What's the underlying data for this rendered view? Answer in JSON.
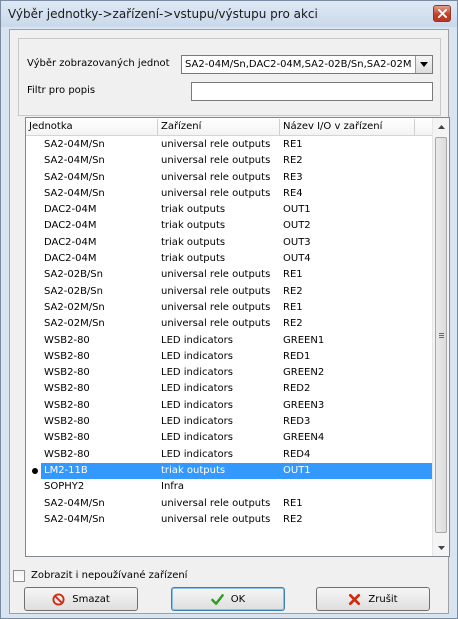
{
  "window": {
    "title": "Výběr jednotky->zařízení->vstupu/výstupu pro akci"
  },
  "filter": {
    "units_label": "Výběr zobrazovaných jednot",
    "units_value": "SA2-04M/Sn,DAC2-04M,SA2-02B/Sn,SA2-02M",
    "description_label": "Filtr pro popis",
    "description_value": ""
  },
  "table": {
    "columns": [
      "Jednotka",
      "Zařízení",
      "Název I/O v zařízení"
    ],
    "rows": [
      {
        "unit": "SA2-04M/Sn",
        "device": "universal rele outputs",
        "io": "RE1"
      },
      {
        "unit": "SA2-04M/Sn",
        "device": "universal rele outputs",
        "io": "RE2"
      },
      {
        "unit": "SA2-04M/Sn",
        "device": "universal rele outputs",
        "io": "RE3"
      },
      {
        "unit": "SA2-04M/Sn",
        "device": "universal rele outputs",
        "io": "RE4"
      },
      {
        "unit": "DAC2-04M",
        "device": "triak outputs",
        "io": "OUT1"
      },
      {
        "unit": "DAC2-04M",
        "device": "triak outputs",
        "io": "OUT2"
      },
      {
        "unit": "DAC2-04M",
        "device": "triak outputs",
        "io": "OUT3"
      },
      {
        "unit": "DAC2-04M",
        "device": "triak outputs",
        "io": "OUT4"
      },
      {
        "unit": "SA2-02B/Sn",
        "device": "universal rele outputs",
        "io": "RE1"
      },
      {
        "unit": "SA2-02B/Sn",
        "device": "universal rele outputs",
        "io": "RE2"
      },
      {
        "unit": "SA2-02M/Sn",
        "device": "universal rele outputs",
        "io": "RE1"
      },
      {
        "unit": "SA2-02M/Sn",
        "device": "universal rele outputs",
        "io": "RE2"
      },
      {
        "unit": "WSB2-80",
        "device": "LED indicators",
        "io": "GREEN1"
      },
      {
        "unit": "WSB2-80",
        "device": "LED indicators",
        "io": "RED1"
      },
      {
        "unit": "WSB2-80",
        "device": "LED indicators",
        "io": "GREEN2"
      },
      {
        "unit": "WSB2-80",
        "device": "LED indicators",
        "io": "RED2"
      },
      {
        "unit": "WSB2-80",
        "device": "LED indicators",
        "io": "GREEN3"
      },
      {
        "unit": "WSB2-80",
        "device": "LED indicators",
        "io": "RED3"
      },
      {
        "unit": "WSB2-80",
        "device": "LED indicators",
        "io": "GREEN4"
      },
      {
        "unit": "WSB2-80",
        "device": "LED indicators",
        "io": "RED4"
      },
      {
        "unit": "LM2-11B",
        "device": "triak outputs",
        "io": "OUT1",
        "selected": true
      },
      {
        "unit": "SOPHY2",
        "device": "Infra",
        "io": ""
      },
      {
        "unit": "SA2-04M/Sn",
        "device": "universal rele outputs",
        "io": "RE1"
      },
      {
        "unit": "SA2-04M/Sn",
        "device": "universal rele outputs",
        "io": "RE2"
      }
    ]
  },
  "show_unused": {
    "label": "Zobrazit i nepoužívané zařízení",
    "checked": false
  },
  "buttons": {
    "delete": {
      "label": "Smazat",
      "icon": "prohibited-icon"
    },
    "ok": {
      "label": "OK",
      "icon": "checkmark-icon"
    },
    "cancel": {
      "label": "Zrušit",
      "icon": "cross-icon"
    }
  },
  "colors": {
    "selection": "#3399ff",
    "ok_icon": "#2e9a1f",
    "cancel_icon": "#d12a12",
    "delete_icon": "#d12a12",
    "close_button": "#c4432b"
  }
}
